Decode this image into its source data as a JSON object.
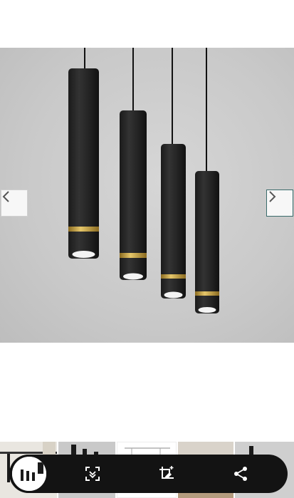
{
  "viewer": {
    "product_image": "black-gold-pendant-lights-photo",
    "prev_icon": "chevron-left-icon",
    "next_icon": "chevron-right-icon"
  },
  "thumbnails": [
    {
      "name": "thumb-pendant-room"
    },
    {
      "name": "thumb-pendant-lights"
    },
    {
      "name": "thumb-dimension-drawing"
    },
    {
      "name": "thumb-dining-room"
    },
    {
      "name": "thumb-pendant-single"
    }
  ],
  "lens_toolbar": {
    "buttons": [
      {
        "name": "lens-scan-icon"
      },
      {
        "name": "crop-edit-icon"
      },
      {
        "name": "share-icon"
      }
    ],
    "colors": {
      "toolbar": "#131313",
      "icon": "#ffffff"
    }
  }
}
